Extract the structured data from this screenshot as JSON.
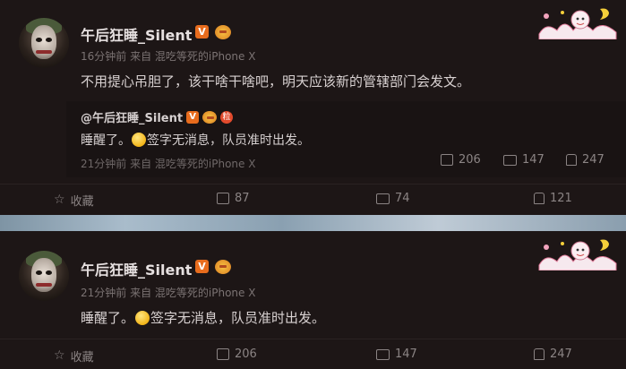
{
  "post1": {
    "username": "午后狂睡_Silent",
    "v_badge": "V",
    "meta": "16分钟前 来自 混吃等死的iPhone X",
    "text": "不用提心吊胆了，该干啥干啥吧，明天应该新的管辖部门会发文。",
    "quoted": {
      "username": "@午后狂睡_Silent",
      "v_badge": "V",
      "red_badge": "粒",
      "text_before": "睡醒了。",
      "text_after": "签字无消息，队员准时出发。",
      "meta": "21分钟前 来自 混吃等死的iPhone X",
      "shares": "206",
      "comments": "147",
      "likes": "247"
    },
    "actions": {
      "favorite": "收藏",
      "shares": "87",
      "comments": "74",
      "likes": "121"
    }
  },
  "post2": {
    "username": "午后狂睡_Silent",
    "v_badge": "V",
    "meta": "21分钟前 来自 混吃等死的iPhone X",
    "text_before": "睡醒了。",
    "text_after": "签字无消息，队员准时出发。",
    "actions": {
      "favorite": "收藏",
      "shares": "206",
      "comments": "147",
      "likes": "247"
    }
  }
}
